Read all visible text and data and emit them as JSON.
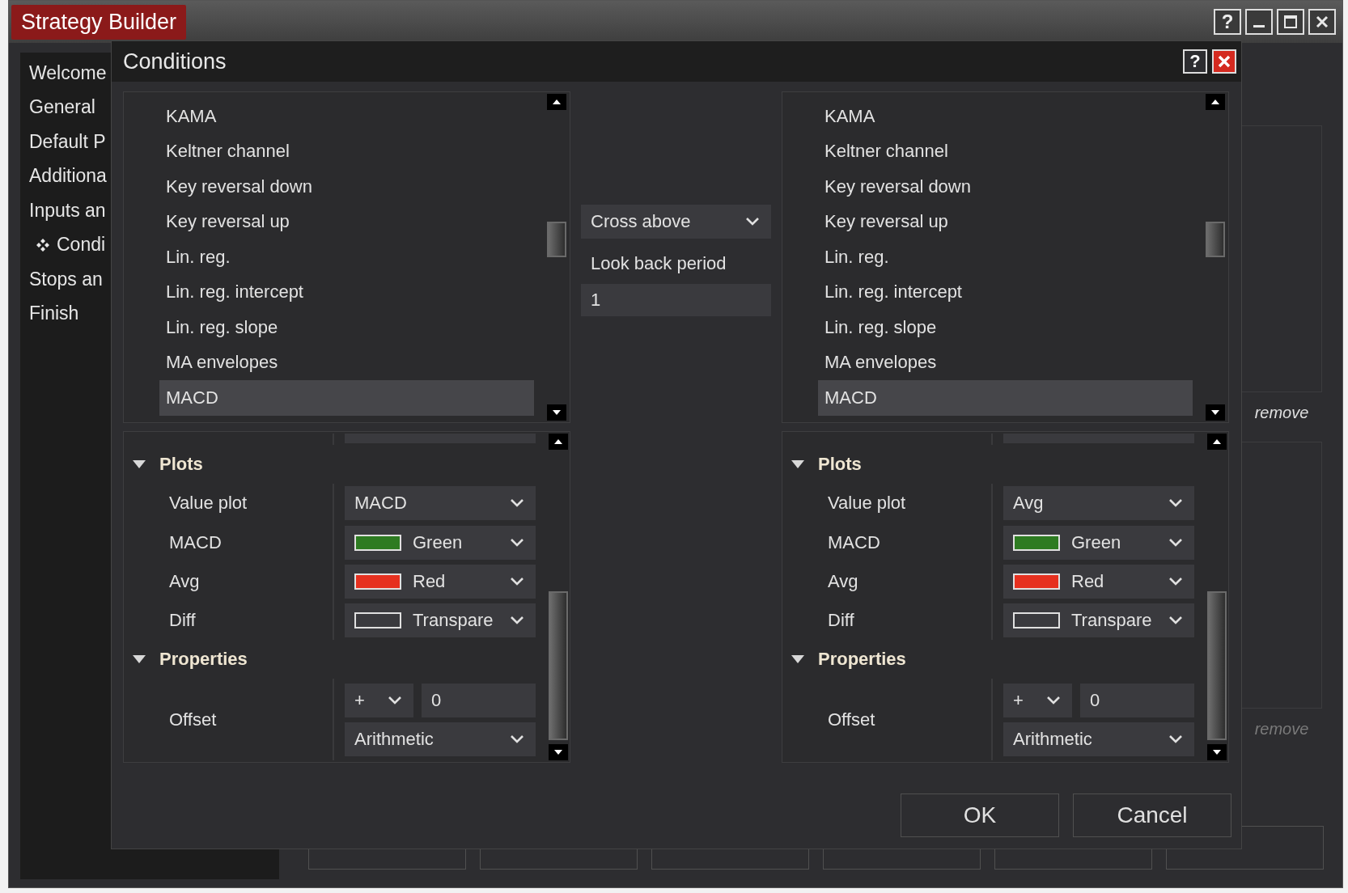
{
  "window": {
    "title": "Strategy Builder",
    "help_label": "?"
  },
  "sidebar": {
    "items": [
      {
        "label": "Welcome",
        "current": false
      },
      {
        "label": "General",
        "current": false
      },
      {
        "label": "Default P",
        "current": false
      },
      {
        "label": "Additiona",
        "current": false
      },
      {
        "label": "Inputs an",
        "current": false
      },
      {
        "label": "Condi",
        "current": true
      },
      {
        "label": "Stops an",
        "current": false
      },
      {
        "label": "Finish",
        "current": false
      }
    ]
  },
  "side_panels": [
    {
      "action": "remove",
      "disabled": false
    },
    {
      "action": "remove",
      "disabled": true
    }
  ],
  "footer_buttons": [
    {
      "kind": "button"
    },
    {
      "kind": "button"
    },
    {
      "kind": "button"
    },
    {
      "kind": "button"
    },
    {
      "kind": "button"
    },
    {
      "kind": "button"
    }
  ],
  "dialog": {
    "title": "Conditions",
    "help_label": "?",
    "left": {
      "list": [
        {
          "label": "KAMA",
          "selected": false
        },
        {
          "label": "Keltner channel",
          "selected": false
        },
        {
          "label": "Key reversal down",
          "selected": false
        },
        {
          "label": "Key reversal up",
          "selected": false
        },
        {
          "label": "Lin. reg.",
          "selected": false
        },
        {
          "label": "Lin. reg. intercept",
          "selected": false
        },
        {
          "label": "Lin. reg. slope",
          "selected": false
        },
        {
          "label": "MA envelopes",
          "selected": false
        },
        {
          "label": "MACD",
          "selected": true
        }
      ],
      "plots": {
        "title": "Plots",
        "expanded": true,
        "rows": [
          {
            "label": "Value plot",
            "kind": "select",
            "value": "MACD"
          },
          {
            "label": "MACD",
            "kind": "color",
            "value": "Green",
            "color": "#2e7b22"
          },
          {
            "label": "Avg",
            "kind": "color",
            "value": "Red",
            "color": "#e6301f"
          },
          {
            "label": "Diff",
            "kind": "color",
            "value": "Transpare"
          }
        ]
      },
      "properties": {
        "title": "Properties",
        "expanded": true,
        "rows": [
          {
            "label": "Offset",
            "sign": "+",
            "value": "0",
            "method": "Arithmetic"
          }
        ]
      }
    },
    "operator": {
      "value": "Cross above",
      "lookback_label": "Look back period",
      "lookback_value": "1"
    },
    "right": {
      "list": [
        {
          "label": "KAMA",
          "selected": false
        },
        {
          "label": "Keltner channel",
          "selected": false
        },
        {
          "label": "Key reversal down",
          "selected": false
        },
        {
          "label": "Key reversal up",
          "selected": false
        },
        {
          "label": "Lin. reg.",
          "selected": false
        },
        {
          "label": "Lin. reg. intercept",
          "selected": false
        },
        {
          "label": "Lin. reg. slope",
          "selected": false
        },
        {
          "label": "MA envelopes",
          "selected": false
        },
        {
          "label": "MACD",
          "selected": true
        }
      ],
      "plots": {
        "title": "Plots",
        "expanded": true,
        "rows": [
          {
            "label": "Value plot",
            "kind": "select",
            "value": "Avg"
          },
          {
            "label": "MACD",
            "kind": "color",
            "value": "Green",
            "color": "#2e7b22"
          },
          {
            "label": "Avg",
            "kind": "color",
            "value": "Red",
            "color": "#e6301f"
          },
          {
            "label": "Diff",
            "kind": "color",
            "value": "Transpare"
          }
        ]
      },
      "properties": {
        "title": "Properties",
        "expanded": true,
        "rows": [
          {
            "label": "Offset",
            "sign": "+",
            "value": "0",
            "method": "Arithmetic"
          }
        ]
      }
    },
    "buttons": [
      {
        "label": "OK"
      },
      {
        "label": "Cancel"
      }
    ]
  }
}
